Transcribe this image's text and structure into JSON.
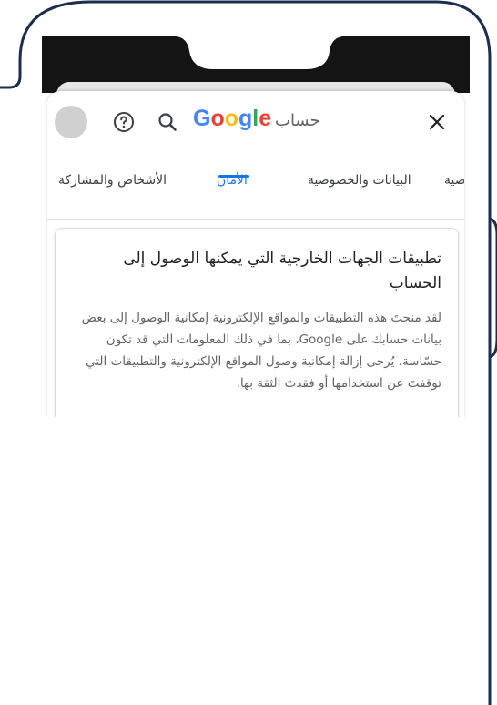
{
  "search": {
    "logo_text": "Google",
    "query": "حساب"
  },
  "icons": {
    "avatar": "avatar",
    "help": "help-icon",
    "search": "search-icon",
    "close": "close-icon"
  },
  "tabs": [
    {
      "label": "الأشخاص والمشاركة",
      "active": false
    },
    {
      "label": "الأمان",
      "active": true
    },
    {
      "label": "البيانات والخصوصية",
      "active": false
    },
    {
      "label": "صية",
      "active": false
    }
  ],
  "card": {
    "title": "تطبيقات الجهات الخارجية التي يمكنها الوصول إلى الحساب",
    "body": "لقد منحتَ هذه التطبيقات والمواقع الإلكترونية إمكانية الوصول إلى بعض بيانات حسابك على Google، بما في ذلك المعلومات التي قد تكون حسّاسة. يُرجى إزالة إمكانية وصول المواقع الإلكترونية والتطبيقات التي توقفتَ عن استخدامها أو فقدتَ الثقة بها."
  },
  "colors": {
    "accent": "#1a73e8",
    "phone_outline": "#1c2e4f",
    "google_blue": "#4285F4",
    "google_red": "#EA4335",
    "google_yellow": "#FBBC05",
    "google_green": "#34A853"
  }
}
